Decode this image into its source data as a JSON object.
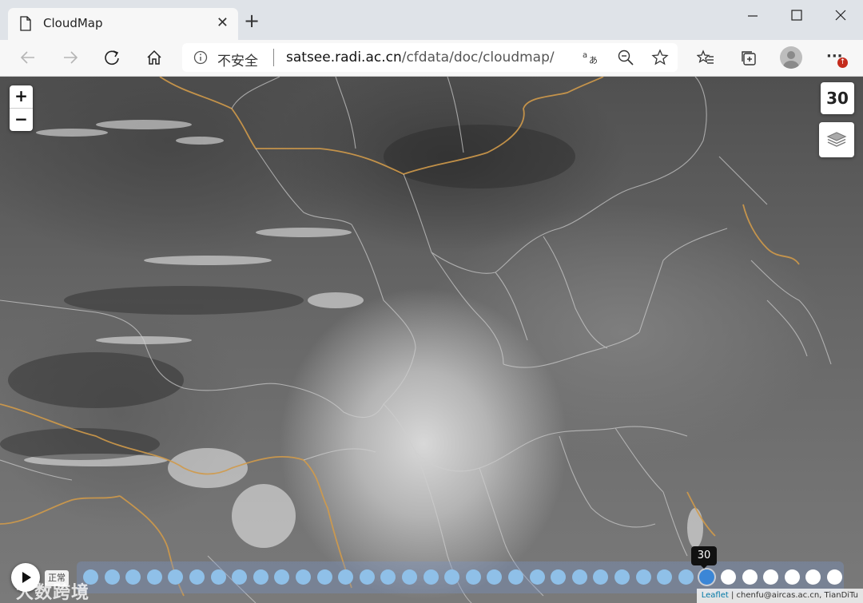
{
  "tab": {
    "title": "CloudMap",
    "close_label": "✕"
  },
  "window": {
    "minimize": "—",
    "maximize": "☐",
    "close": "✕"
  },
  "address_bar": {
    "security_label": "不安全",
    "url_host": "satsee.radi.ac.cn",
    "url_path": "/cfdata/doc/cloudmap/"
  },
  "toolbar": {
    "more": "···",
    "notification_badge": "↑"
  },
  "map": {
    "zoom_in": "+",
    "zoom_out": "−",
    "frame_number": "30",
    "timeline": {
      "total_frames": 36,
      "current_frame": 30,
      "tooltip": "30",
      "speed_label": "正常"
    },
    "attribution": {
      "leaflet": "Leaflet",
      "sep": " | ",
      "credit": "chenfu@aircas.ac.cn, TianDiTu"
    },
    "watermark": "大数跨境"
  },
  "colors": {
    "timeline_done": "#8fc0e8",
    "timeline_current": "#3b86d6",
    "timeline_future": "#ffffff",
    "national_border": "#d09a4a",
    "province_border": "#cfcfcf"
  }
}
